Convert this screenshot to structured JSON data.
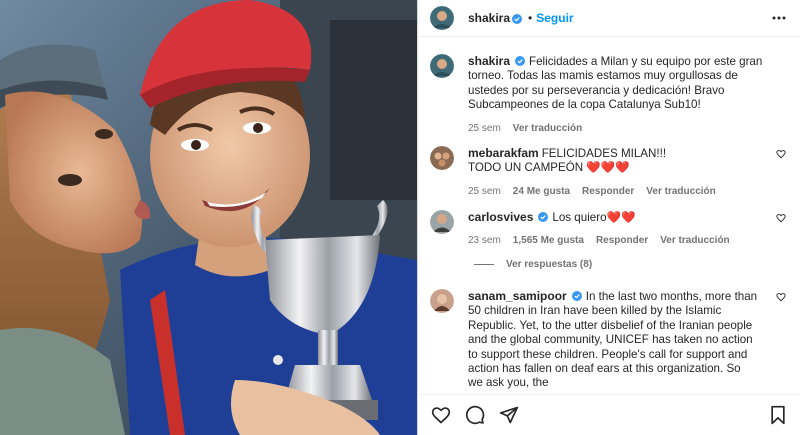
{
  "post": {
    "author": "shakira",
    "follow_label": "Seguir",
    "separator": "•"
  },
  "caption": {
    "username": "shakira",
    "text": "Felicidades a Milan y su equipo por este gran torneo. Todas las mamis estamos muy orgullosas de ustedes por su perseverancia y dedicación! Bravo Subcampeones de la copa Catalunya Sub10!",
    "time": "25 sem",
    "translate": "Ver traducción"
  },
  "comments": [
    {
      "username": "mebarakfam",
      "text_line1": "FELICIDADES MILAN!!!",
      "text_line2": "TODO UN CAMPEÓN ❤️❤️❤️",
      "time": "25 sem",
      "likes": "24 Me gusta",
      "reply": "Responder",
      "translate": "Ver traducción"
    },
    {
      "username": "carlosvives",
      "text": "Los quiero❤️❤️",
      "time": "23 sem",
      "likes": "1,565 Me gusta",
      "reply": "Responder",
      "translate": "Ver traducción",
      "view_replies": "Ver respuestas (8)"
    },
    {
      "username": "sanam_samipoor",
      "text": "In the last two months, more than 50 children in Iran have been killed by the Islamic Republic. Yet, to the utter disbelief of the Iranian people and the global community, UNICEF has taken no action to support these children. People's call for support and action has fallen on deaf ears at this organization. So we ask you, the"
    }
  ],
  "icons": {
    "like": "heart-icon",
    "comment": "comment-icon",
    "share": "share-icon",
    "save": "bookmark-icon",
    "more": "more-options-icon",
    "verified": "verified-badge-icon"
  },
  "colors": {
    "accent": "#0095f6",
    "verified": "#3897f0",
    "muted": "#737373",
    "text": "#262626"
  }
}
